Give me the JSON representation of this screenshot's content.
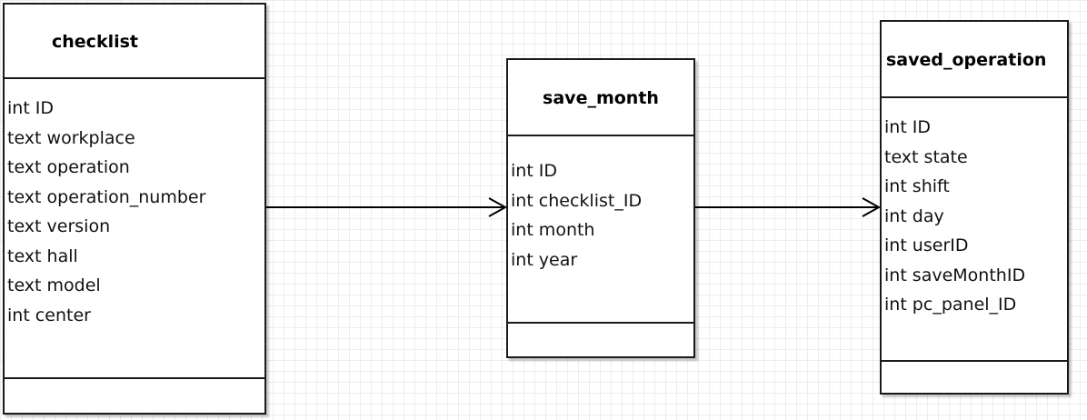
{
  "entities": [
    {
      "name": "checklist",
      "attributes": [
        "int ID",
        "text workplace",
        "text operation",
        "text operation_number",
        "text version",
        "text hall",
        "text model",
        "int center"
      ]
    },
    {
      "name": "save_month",
      "attributes": [
        "int ID",
        "int checklist_ID",
        "int month",
        "int year"
      ]
    },
    {
      "name": "saved_operation",
      "attributes": [
        "int ID",
        "text state",
        "int shift",
        "int day",
        "int userID",
        "int saveMonthID",
        "int pc_panel_ID"
      ]
    }
  ],
  "relations": [
    {
      "from": "checklist",
      "to": "save_month",
      "arrow": "open"
    },
    {
      "from": "save_month",
      "to": "saved_operation",
      "arrow": "open"
    }
  ],
  "colors": {
    "border": "#1a1a1a",
    "grid": "#ededed",
    "background": "#ffffff"
  }
}
